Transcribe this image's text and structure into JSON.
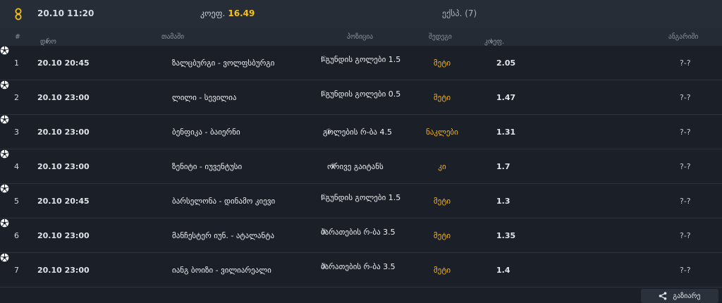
{
  "top": {
    "date": "20.10 11:20",
    "odds_label": "კოეფ.",
    "odds_value": "16.49",
    "express": "ექსპ. (7)"
  },
  "header": {
    "num": "#",
    "date": "დრო",
    "game": "თამაში",
    "position": "პოზიცია",
    "outcome": "შედეგი",
    "odds": "კოეფ.",
    "result": "ანგარიში",
    "sort_arrow": "↓"
  },
  "rows": [
    {
      "num": "1",
      "date": "20.10 20:45",
      "game": "ზალცბურგი - ვოლფსბურგი",
      "position": "I გუნდის გოლები 1.5",
      "pos_sub": "①",
      "outcome": "მეტი",
      "odds": "2.05",
      "result": "?-?"
    },
    {
      "num": "2",
      "date": "20.10 23:00",
      "game": "ლილი - სევილია",
      "position": "I გუნდის გოლები 0.5",
      "pos_sub": "①",
      "outcome": "მეტი",
      "odds": "1.47",
      "result": "?-?"
    },
    {
      "num": "3",
      "date": "20.10 23:00",
      "game": "ბენფიკა - ბაიერნი",
      "position": "გოლების რ-ბა 4.5",
      "pos_sub": "①",
      "outcome": "ნაკლები",
      "odds": "1.31",
      "result": "?-?"
    },
    {
      "num": "4",
      "date": "20.10 23:00",
      "game": "ზენიტი - იუვენტუსი",
      "position": "ორივე გაიტანს",
      "pos_sub": "①",
      "outcome": "კი",
      "odds": "1.7",
      "result": "?-?"
    },
    {
      "num": "5",
      "date": "20.10 20:45",
      "game": "ბარსელონა - დინამო კიევი",
      "position": "I გუნდის გოლები 1.5",
      "pos_sub": "①",
      "outcome": "მეტი",
      "odds": "1.3",
      "result": "?-?"
    },
    {
      "num": "6",
      "date": "20.10 23:00",
      "game": "მანჩესტერ იუნ. - ატალანტა",
      "position": "ბარათების რ-ბა 3.5",
      "pos_sub": "③",
      "outcome": "მეტი",
      "odds": "1.35",
      "result": "?-?"
    },
    {
      "num": "7",
      "date": "20.10 23:00",
      "game": "იანგ ბოიზი - ვილიარეალი",
      "position": "ბარათების რ-ბა 3.5",
      "pos_sub": "③",
      "outcome": "მეტი",
      "odds": "1.4",
      "result": "?-?"
    }
  ],
  "share": {
    "label": "გაზიარე"
  },
  "colors": {
    "accent": "#f5b21b",
    "background": "#1b2028",
    "topbar": "#272d37"
  }
}
